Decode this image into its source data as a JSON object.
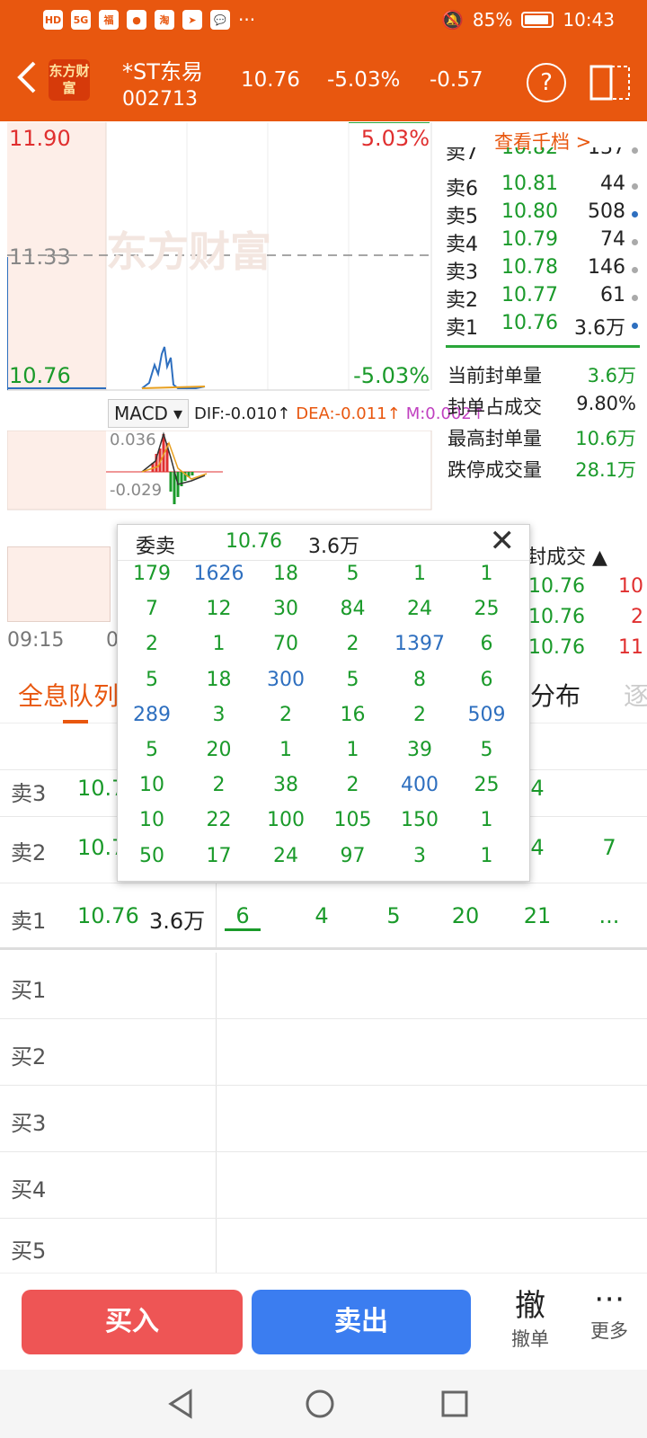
{
  "status": {
    "battery": "85%",
    "time": "10:43",
    "left_badges": [
      "HD",
      "5G"
    ]
  },
  "header": {
    "logo_text": "东方财富",
    "stock_name": "*ST东易",
    "stock_code": "002713",
    "price": "10.76",
    "pct": "-5.03%",
    "change": "-0.57",
    "help_label": "?"
  },
  "chart": {
    "high_label": "11.90",
    "mid_label": "11.33",
    "low_label": "10.76",
    "high_pct": "5.03%",
    "low_pct": "-5.03%",
    "watermark": "东方财富",
    "macd_label": "MACD",
    "dif": "DIF:-0.010↑",
    "dea": "DEA:-0.011↑",
    "m": "M:0.002↑",
    "vol_hi": "0.036",
    "vol_lo": "-0.029",
    "time_start": "09:15",
    "time_2": "0"
  },
  "orderbook": {
    "link": "查看千档 >",
    "rows": [
      {
        "name": "卖7",
        "price": "10.82",
        "vol": "137",
        "dot": "gray"
      },
      {
        "name": "卖6",
        "price": "10.81",
        "vol": "44",
        "dot": "gray"
      },
      {
        "name": "卖5",
        "price": "10.80",
        "vol": "508",
        "dot": "blue"
      },
      {
        "name": "卖4",
        "price": "10.79",
        "vol": "74",
        "dot": "gray"
      },
      {
        "name": "卖3",
        "price": "10.78",
        "vol": "146",
        "dot": "gray"
      },
      {
        "name": "卖2",
        "price": "10.77",
        "vol": "61",
        "dot": "gray"
      },
      {
        "name": "卖1",
        "price": "10.76",
        "vol": "3.6万",
        "dot": "blue"
      }
    ],
    "stats": [
      {
        "k": "当前封单量",
        "v": "3.6万"
      },
      {
        "k": "封单占成交",
        "v": "9.80%"
      },
      {
        "k": "最高封单量",
        "v": "10.6万"
      },
      {
        "k": "跌停成交量",
        "v": "28.1万"
      }
    ]
  },
  "trades": {
    "header": "封成交 ▲",
    "rows": [
      {
        "p": "10.76",
        "v": "10"
      },
      {
        "p": "10.76",
        "v": "2"
      },
      {
        "p": "10.76",
        "v": "11"
      }
    ]
  },
  "tabs": {
    "tab1": "全息队列",
    "tab2": "分布",
    "tab3": "逐"
  },
  "queue": {
    "rows": [
      {
        "name": "卖3",
        "price": "10.7",
        "vol": "",
        "cells": [
          "4"
        ]
      },
      {
        "name": "卖2",
        "price": "10.7",
        "vol": "",
        "cells": [
          "4",
          "7"
        ]
      },
      {
        "name": "卖1",
        "price": "10.76",
        "vol": "3.6万",
        "cells": [
          "6",
          "4",
          "5",
          "20",
          "21",
          "..."
        ]
      },
      {
        "name": "买1",
        "price": "",
        "vol": "",
        "cells": []
      },
      {
        "name": "买2",
        "price": "",
        "vol": "",
        "cells": []
      },
      {
        "name": "买3",
        "price": "",
        "vol": "",
        "cells": []
      },
      {
        "name": "买4",
        "price": "",
        "vol": "",
        "cells": []
      },
      {
        "name": "买5",
        "price": "",
        "vol": "",
        "cells": []
      }
    ]
  },
  "popup": {
    "title": "委卖",
    "price": "10.76",
    "vol": "3.6万",
    "close": "✕",
    "grid": [
      [
        "179",
        "1626",
        "18",
        "5",
        "1",
        "1"
      ],
      [
        "7",
        "12",
        "30",
        "84",
        "24",
        "25"
      ],
      [
        "2",
        "1",
        "70",
        "2",
        "1397",
        "6"
      ],
      [
        "5",
        "18",
        "300",
        "5",
        "8",
        "6"
      ],
      [
        "289",
        "3",
        "2",
        "16",
        "2",
        "509"
      ],
      [
        "5",
        "20",
        "1",
        "1",
        "39",
        "5"
      ],
      [
        "10",
        "2",
        "38",
        "2",
        "400",
        "25"
      ],
      [
        "10",
        "22",
        "100",
        "105",
        "150",
        "1"
      ],
      [
        "50",
        "17",
        "24",
        "97",
        "3",
        "1"
      ]
    ],
    "blue_cells": [
      "1626",
      "1397",
      "300",
      "289",
      "509",
      "400"
    ]
  },
  "actions": {
    "buy": "买入",
    "sell": "卖出",
    "cancel_icon": "撤",
    "cancel": "撤单",
    "more_icon": "⋯",
    "more": "更多"
  },
  "colors": {
    "brand": "#e8570f",
    "buy": "#ee5555",
    "sell": "#3b7df0",
    "down": "#1a9a2a",
    "up": "#e02f2f"
  }
}
